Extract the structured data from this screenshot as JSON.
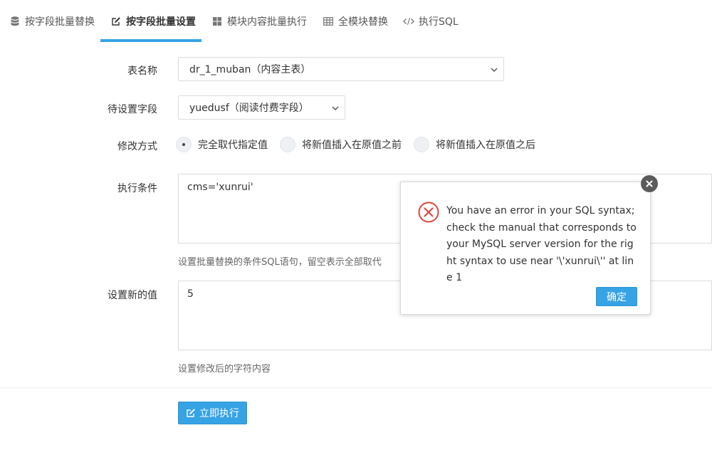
{
  "tabs": [
    {
      "label": "按字段批量替换",
      "icon": "database-icon"
    },
    {
      "label": "按字段批量设置",
      "icon": "edit-icon",
      "active": true
    },
    {
      "label": "模块内容批量执行",
      "icon": "grid-icon"
    },
    {
      "label": "全模块替换",
      "icon": "table-icon"
    },
    {
      "label": "执行SQL",
      "icon": "code-icon"
    }
  ],
  "form": {
    "table_name": {
      "label": "表名称",
      "value": "dr_1_muban（内容主表）"
    },
    "field": {
      "label": "待设置字段",
      "value": "yuedusf（阅读付费字段）"
    },
    "mode": {
      "label": "修改方式",
      "options": [
        "完全取代指定值",
        "将新值插入在原值之前",
        "将新值插入在原值之后"
      ],
      "selected": "完全取代指定值"
    },
    "condition": {
      "label": "执行条件",
      "value": "cms='xunrui'",
      "help": "设置批量替换的条件SQL语句，留空表示全部取代"
    },
    "new_value": {
      "label": "设置新的值",
      "value": "5",
      "help": "设置修改后的字符内容"
    },
    "submit_label": "立即执行"
  },
  "dialog": {
    "message": "You have an error in your SQL syntax; check the manual that corresponds to your MySQL server version for the right syntax to use near '\\'xunrui\\'' at line 1",
    "ok_label": "确定"
  },
  "colors": {
    "accent": "#36a3e4",
    "error": "#e0463c"
  }
}
